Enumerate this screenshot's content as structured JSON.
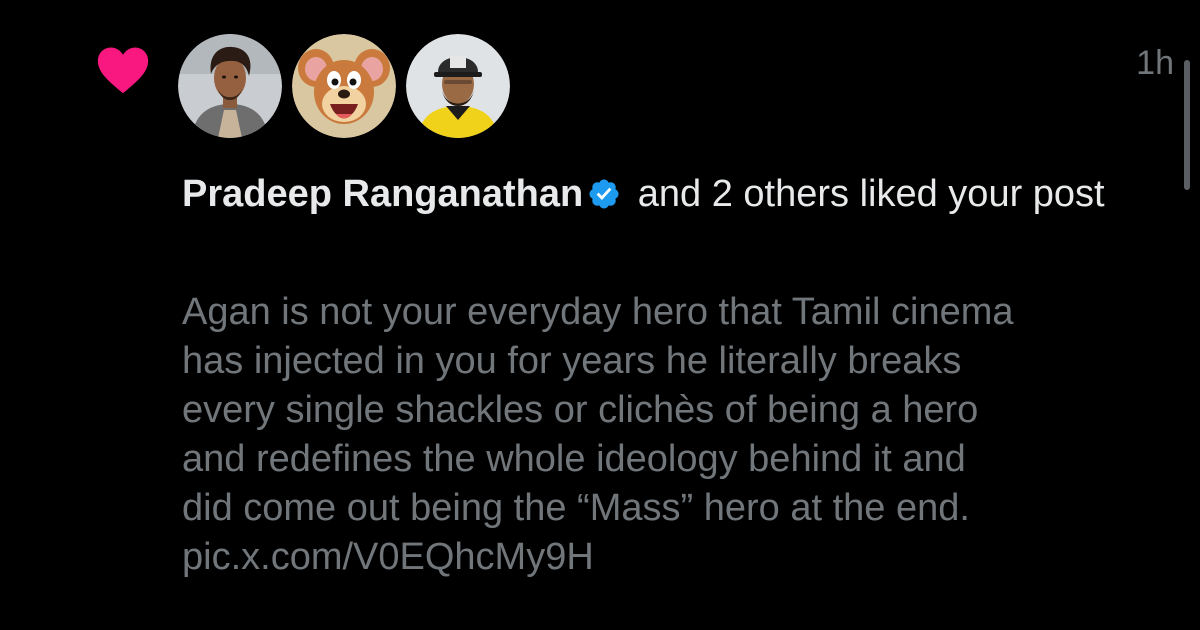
{
  "notification": {
    "timestamp": "1h",
    "actor_name": "Pradeep Ranganathan",
    "action_text": " and 2 others liked your post",
    "post_text": "Agan is not your everyday hero that Tamil cinema\nhas injected in you for years he literally breaks\nevery single shackles or clichès of being a hero\nand redefines the whole ideology behind it and\ndid come out being the “Mass” hero at the end.",
    "post_link": "pic.x.com/V0EQhcMy9H"
  },
  "icons": {
    "like": "heart-icon",
    "verified": "verified-badge-icon"
  },
  "colors": {
    "background": "#000000",
    "heart": "#f91880",
    "verified": "#1d9bf0",
    "primary_text": "#e7e9ea",
    "secondary_text": "#71767b"
  }
}
